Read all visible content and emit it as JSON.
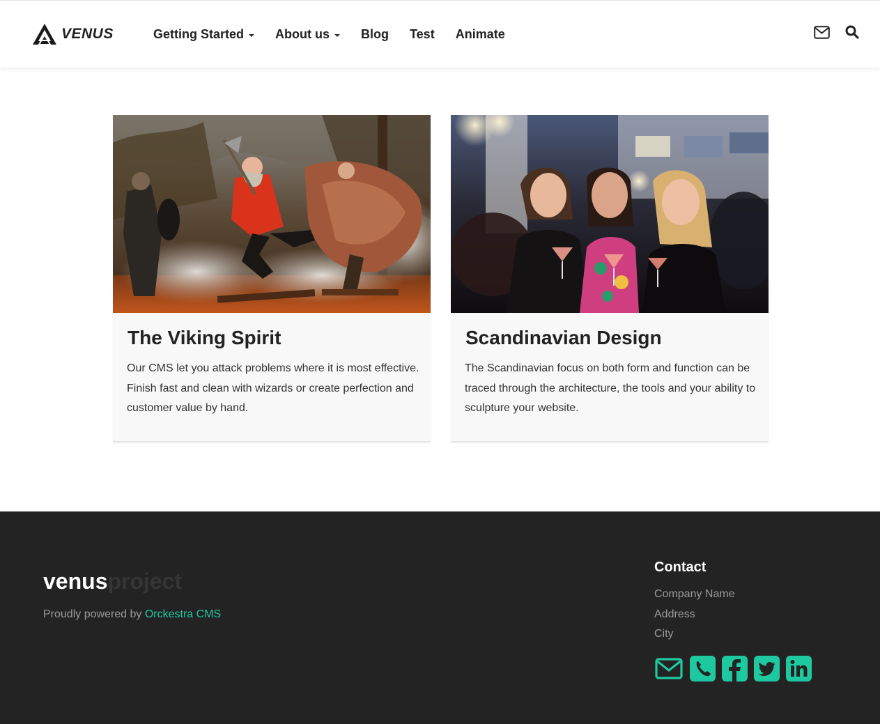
{
  "brand": {
    "logo_text": "VENUS"
  },
  "nav": [
    {
      "label": "Getting Started",
      "dropdown": true
    },
    {
      "label": "About us",
      "dropdown": true
    },
    {
      "label": "Blog",
      "dropdown": false
    },
    {
      "label": "Test",
      "dropdown": false
    },
    {
      "label": "Animate",
      "dropdown": false
    }
  ],
  "header_icons": [
    "mail-icon",
    "search-icon"
  ],
  "cards": [
    {
      "title": "The Viking Spirit",
      "text": "Our CMS let you attack problems where it is most effective. Finish fast and clean with wizards or create perfection and customer value by hand.",
      "image": "vikings-jumping-photo"
    },
    {
      "title": "Scandinavian Design",
      "text": "The Scandinavian focus on both form and function can be traced through the architecture, the tools and your ability to sculpture your website.",
      "image": "women-laughing-with-cocktails-photo"
    }
  ],
  "footer": {
    "brand_main": "venus",
    "brand_sub": "project",
    "powered_prefix": "Proudly powered by ",
    "powered_link": "Orckestra CMS",
    "contact_title": "Contact",
    "contact_lines": [
      "Company Name",
      "Address",
      "City"
    ],
    "social_icons": [
      "envelope-icon",
      "phone-icon",
      "facebook-icon",
      "twitter-icon",
      "linkedin-icon"
    ]
  },
  "colors": {
    "accent": "#1ec99f",
    "footer_bg": "#232323",
    "card_bg": "#f8f8f8",
    "text": "#222222"
  }
}
